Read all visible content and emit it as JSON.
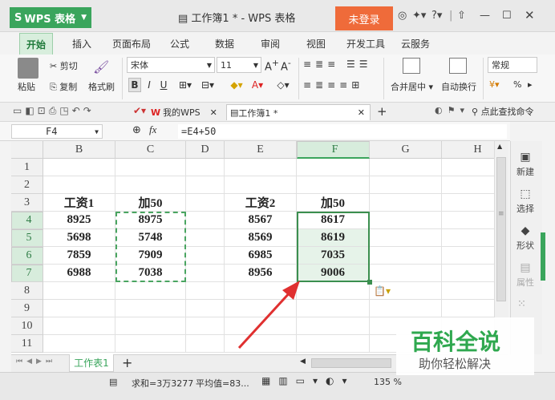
{
  "app": {
    "name": "WPS 表格",
    "doc_title": "工作簿1 * - WPS 表格",
    "login": "未登录"
  },
  "menu": [
    "开始",
    "插入",
    "页面布局",
    "公式",
    "数据",
    "审阅",
    "视图",
    "开发工具",
    "云服务"
  ],
  "ribbon": {
    "paste": "粘贴",
    "cut": "剪切",
    "copy": "复制",
    "format_painter": "格式刷",
    "font_name": "宋体",
    "font_size": "11",
    "merge_center": "合并居中",
    "wrap_text": "自动换行",
    "number_format": "常规",
    "percent": "%"
  },
  "quick": {
    "mywps": "我的WPS",
    "doc_tab": "工作簿1 *",
    "search": "点此查找命令"
  },
  "formula_bar": {
    "cell_ref": "F4",
    "fx": "fx",
    "formula": "=E4+50"
  },
  "sheet": {
    "columns": [
      "B",
      "C",
      "D",
      "E",
      "F",
      "G",
      "H"
    ],
    "rows": [
      "1",
      "2",
      "3",
      "4",
      "5",
      "6",
      "7",
      "8",
      "9",
      "10",
      "11"
    ],
    "headers": {
      "B3": "工资1",
      "C3": "加50",
      "E3": "工资2",
      "F3": "加50"
    },
    "values": {
      "B": [
        "8925",
        "5698",
        "7859",
        "6988"
      ],
      "C": [
        "8975",
        "5748",
        "7909",
        "7038"
      ],
      "E": [
        "8567",
        "8569",
        "6985",
        "8956"
      ],
      "F": [
        "8617",
        "8619",
        "7035",
        "9006"
      ]
    },
    "tab": "工作表1"
  },
  "side_panel": [
    "新建",
    "选择",
    "形状",
    "属性"
  ],
  "status": {
    "sum": "求和=3万3277",
    "avg": "平均值=83...",
    "zoom": "135 %"
  },
  "watermark": {
    "title": "百科全说",
    "subtitle": "助你轻松解决"
  },
  "colors": {
    "accent": "#3aa55c",
    "login": "#ef6b3a",
    "arrow": "#e03030"
  }
}
